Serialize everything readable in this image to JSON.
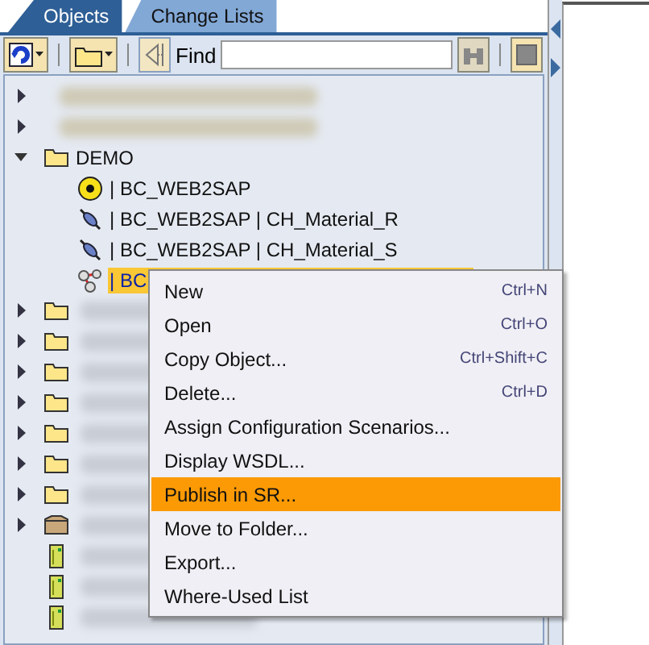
{
  "tabs": [
    {
      "label": "Objects",
      "selected": true
    },
    {
      "label": "Change Lists",
      "selected": false
    }
  ],
  "toolbar": {
    "find_label": "Find"
  },
  "tree": [
    {
      "kind": "folder-blurred",
      "expanded": false
    },
    {
      "kind": "folder-blurred",
      "expanded": false
    },
    {
      "kind": "folder",
      "label": "DEMO",
      "expanded": true,
      "selected": false,
      "children": [
        {
          "kind": "target",
          "label": "| BC_WEB2SAP",
          "selected": false
        },
        {
          "kind": "plug",
          "label": "| BC_WEB2SAP | CH_Material_R",
          "selected": false
        },
        {
          "kind": "plug",
          "label": "| BC_WEB2SAP | CH_Material_S",
          "selected": false
        },
        {
          "kind": "molecule",
          "label": "| BC",
          "selected": true
        }
      ]
    },
    {
      "kind": "folder",
      "expanded": false
    },
    {
      "kind": "folder",
      "expanded": false
    },
    {
      "kind": "folder",
      "expanded": false
    },
    {
      "kind": "folder",
      "expanded": false
    },
    {
      "kind": "folder",
      "expanded": false
    },
    {
      "kind": "folder",
      "expanded": false
    },
    {
      "kind": "folder",
      "expanded": false
    },
    {
      "kind": "box",
      "expanded": false
    },
    {
      "kind": "file"
    },
    {
      "kind": "file"
    },
    {
      "kind": "file"
    }
  ],
  "context_menu": [
    {
      "label": "New",
      "shortcut": "Ctrl+N",
      "selected": false
    },
    {
      "label": "Open",
      "shortcut": "Ctrl+O",
      "selected": false
    },
    {
      "label": "Copy Object...",
      "shortcut": "Ctrl+Shift+C",
      "selected": false
    },
    {
      "label": "Delete...",
      "shortcut": "Ctrl+D",
      "selected": false
    },
    {
      "label": "Assign Configuration Scenarios...",
      "selected": false
    },
    {
      "label": "Display WSDL...",
      "selected": false
    },
    {
      "label": "Publish in SR...",
      "selected": true
    },
    {
      "label": "Move to Folder...",
      "selected": false
    },
    {
      "label": "Export...",
      "selected": false
    },
    {
      "label": "Where-Used List",
      "selected": false
    }
  ]
}
